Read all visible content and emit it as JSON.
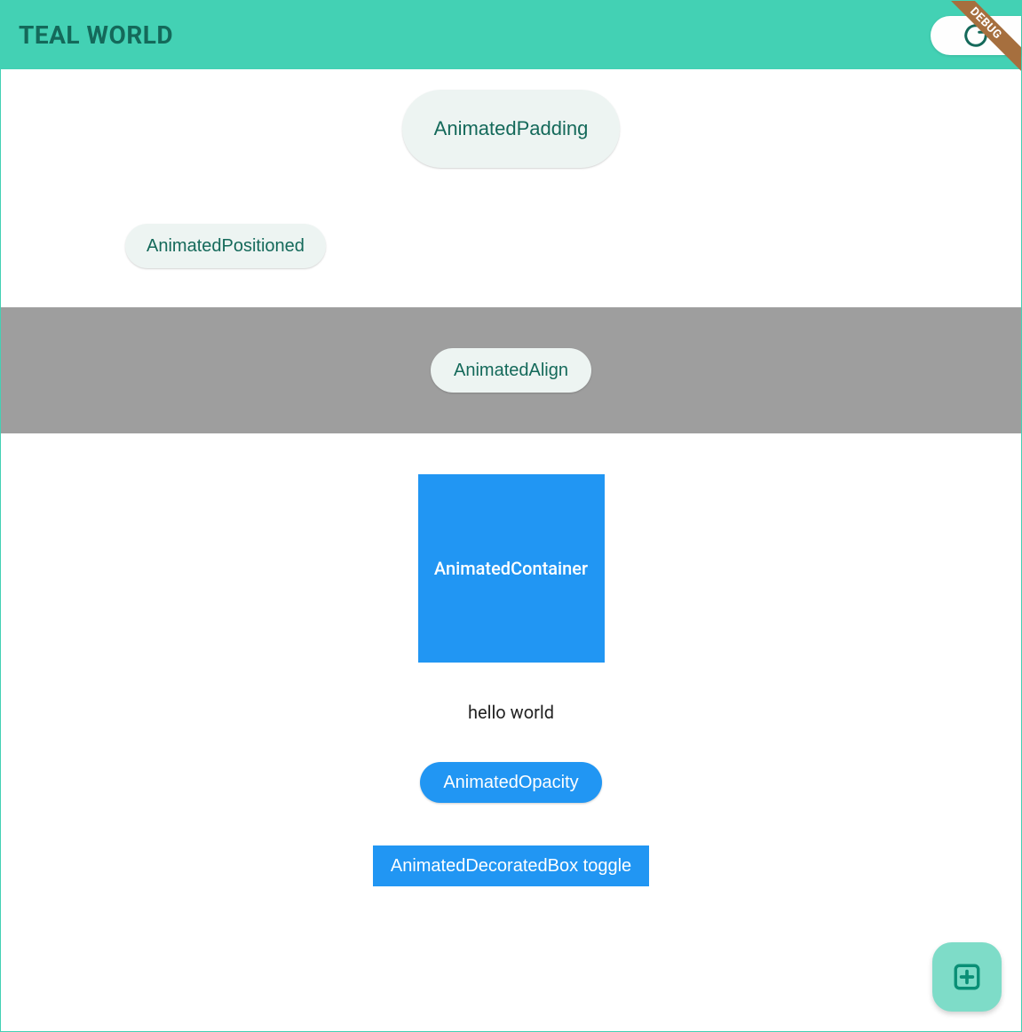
{
  "header": {
    "title": "TEAL WORLD",
    "refresh_icon": "refresh",
    "debug_label": "DEBUG"
  },
  "sections": {
    "padding_btn": "AnimatedPadding",
    "positioned_btn": "AnimatedPositioned",
    "align_btn": "AnimatedAlign",
    "container_label": "AnimatedContainer",
    "opacity_text": "hello world",
    "opacity_btn": "AnimatedOpacity",
    "decorated_btn": "AnimatedDecoratedBox toggle"
  },
  "fab": {
    "icon": "plus"
  },
  "colors": {
    "teal_bar": "#43d1b4",
    "teal_dark": "#14695a",
    "pill_bg": "#edf4f2",
    "section_grey": "#9e9e9e",
    "blue": "#2196f3",
    "fab_bg": "#7edcc8",
    "fab_icon": "#0a8f76"
  }
}
